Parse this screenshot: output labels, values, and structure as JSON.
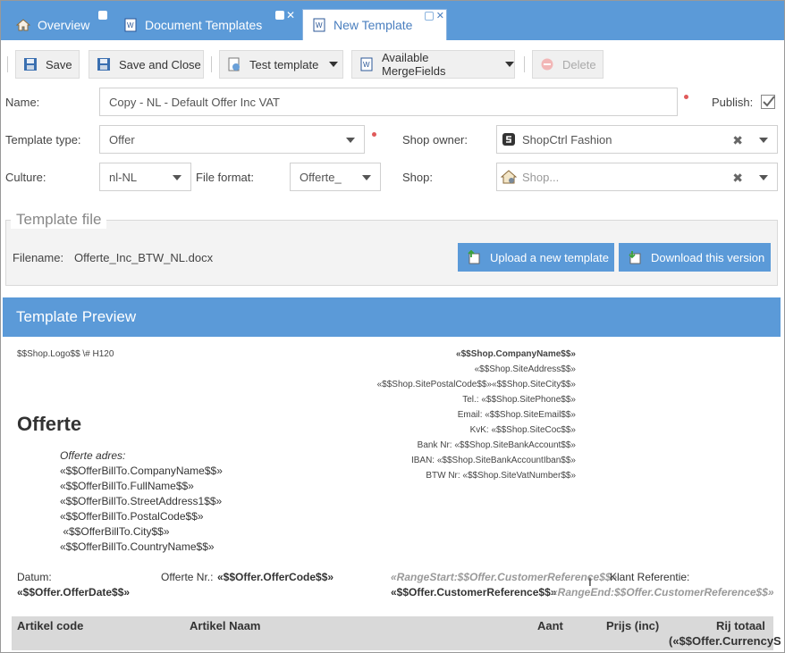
{
  "tabs": {
    "overview": "Overview",
    "document_templates": "Document Templates",
    "new_template": "New Template"
  },
  "toolbar": {
    "save": "Save",
    "save_and_close": "Save and Close",
    "test_template": "Test template",
    "available_mergefields": "Available MergeFields",
    "delete": "Delete"
  },
  "form": {
    "name_label": "Name:",
    "name_value": "Copy - NL - Default Offer Inc VAT",
    "publish_label": "Publish:",
    "publish_checked": true,
    "template_type_label": "Template type:",
    "template_type_value": "Offer",
    "shop_owner_label": "Shop owner:",
    "shop_owner_value": "ShopCtrl Fashion",
    "culture_label": "Culture:",
    "culture_value": "nl-NL",
    "file_format_label": "File format:",
    "file_format_value": "Offerte_",
    "shop_label": "Shop:",
    "shop_placeholder": "Shop..."
  },
  "template_file": {
    "legend": "Template file",
    "filename_label": "Filename:",
    "filename_value": "Offerte_Inc_BTW_NL.docx",
    "upload_button": "Upload a new template",
    "download_button": "Download this version"
  },
  "preview": {
    "title": "Template Preview",
    "logo_field": "$$Shop.Logo$$ \\# H120",
    "company_lines": [
      "«$$Shop.CompanyName$$»",
      "«$$Shop.SiteAddress$$»",
      "«$$Shop.SitePostalCode$$»«$$Shop.SiteCity$$»",
      "Tel.: «$$Shop.SitePhone$$»",
      "Email: «$$Shop.SiteEmail$$»",
      "KvK: «$$Shop.SiteCoc$$»",
      "Bank Nr: «$$Shop.SiteBankAccount$$»",
      "IBAN: «$$Shop.SiteBankAccountIban$$»",
      "BTW Nr: «$$Shop.SiteVatNumber$$»"
    ],
    "heading": "Offerte",
    "address_label": "Offerte adres:",
    "address_lines": [
      "«$$OfferBillTo.CompanyName$$»",
      "«$$OfferBillTo.FullName$$»",
      "«$$OfferBillTo.StreetAddress1$$»",
      "«$$OfferBillTo.PostalCode$$»",
      " «$$OfferBillTo.City$$»",
      "«$$OfferBillTo.CountryName$$»"
    ],
    "datum_label": "Datum:",
    "datum_value": "«$$Offer.OfferDate$$»",
    "offerte_nr_label": "Offerte Nr.:",
    "offerte_nr_value": "«$$Offer.OfferCode$$»",
    "range_start": "«RangeStart:$$Offer.CustomerReference$$»",
    "klant_ref_label": "Klant Referentie:",
    "customer_ref": "«$$Offer.CustomerReference$$»",
    "range_end": "«RangeEnd:$$Offer.CustomerReference$$»",
    "table_headers": {
      "artikel_code": "Artikel code",
      "artikel_naam": "Artikel Naam",
      "aant": "Aant",
      "prijs": "Prijs (inc)",
      "rij_totaal": "Rij totaal",
      "currency": "(«$$Offer.CurrencySy"
    }
  },
  "colors": {
    "brand_blue": "#5b9ad8",
    "required_dot": "#e05a5a"
  }
}
